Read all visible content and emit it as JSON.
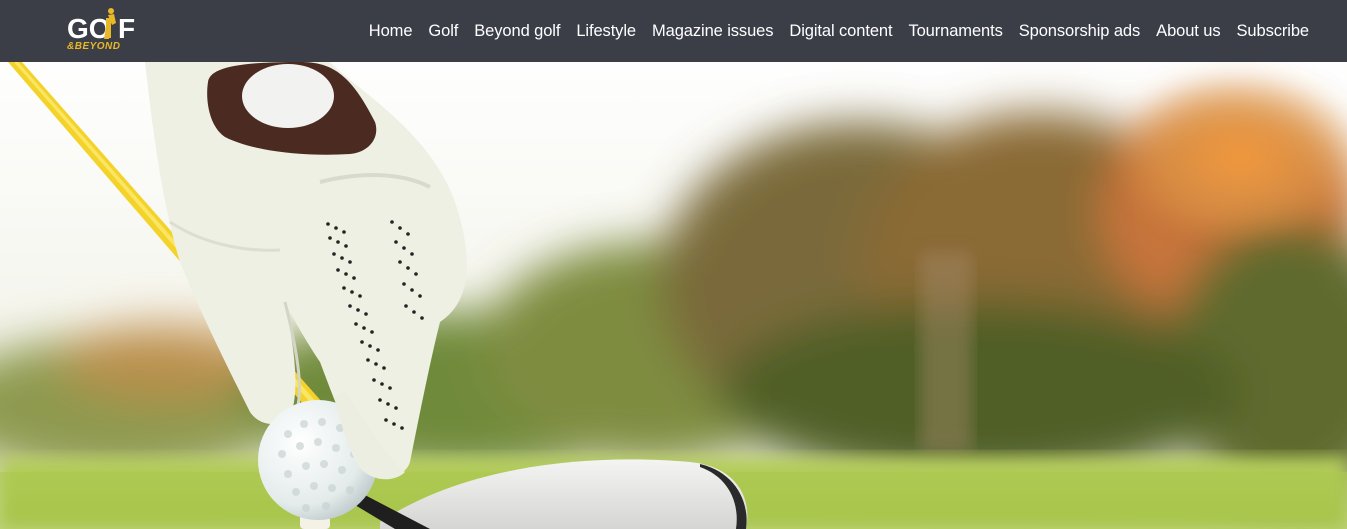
{
  "brand": {
    "logo_main": "GOLF",
    "logo_sub": "&BEYOND",
    "colors": {
      "navbar": "#3b3e47",
      "logo_accent": "#e8b828",
      "text": "#ffffff"
    }
  },
  "nav": {
    "items": [
      {
        "label": "Home"
      },
      {
        "label": "Golf"
      },
      {
        "label": "Beyond golf"
      },
      {
        "label": "Lifestyle"
      },
      {
        "label": "Magazine issues"
      },
      {
        "label": "Digital content"
      },
      {
        "label": "Tournaments"
      },
      {
        "label": "Sponsorship ads"
      },
      {
        "label": "About us"
      },
      {
        "label": "Subscribe"
      }
    ]
  },
  "hero": {
    "icon": "gloved-hand-placing-golf-ball-on-tee-photo"
  }
}
